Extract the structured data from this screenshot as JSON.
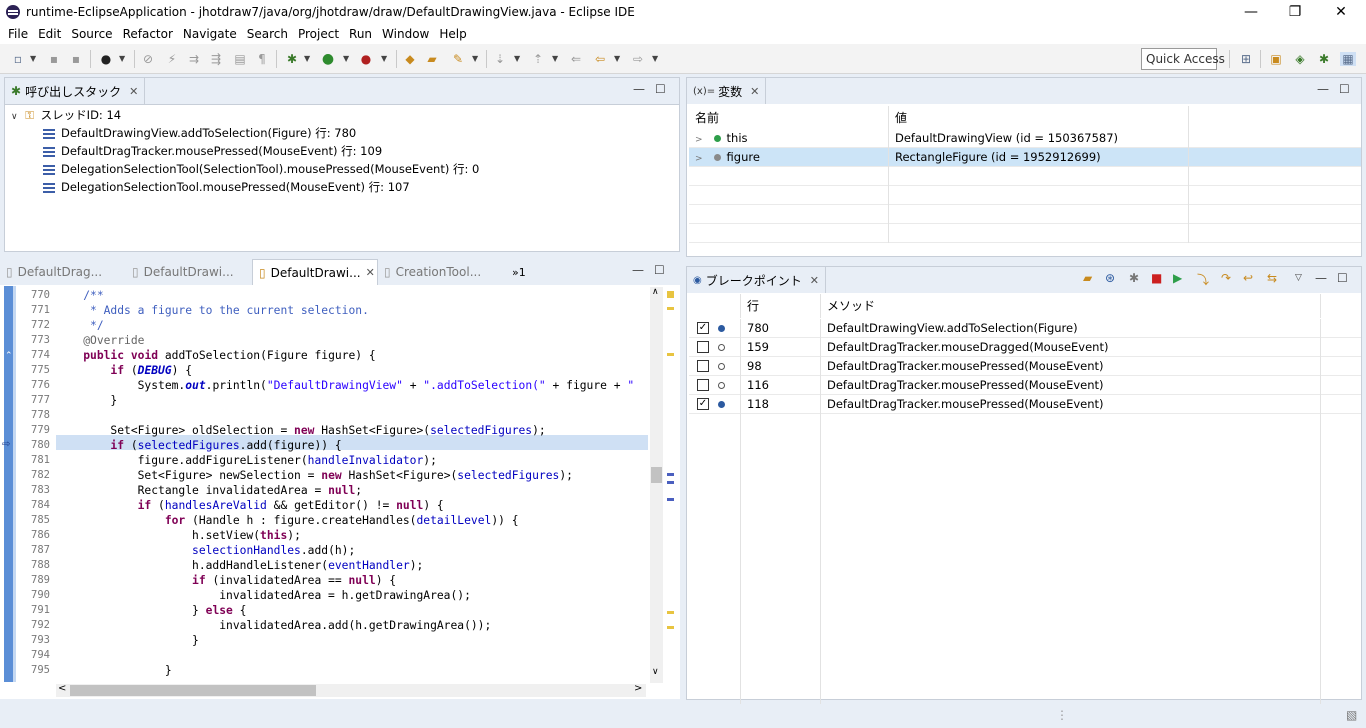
{
  "window": {
    "title": "runtime-EclipseApplication - jhotdraw7/java/org/jhotdraw/draw/DefaultDrawingView.java - Eclipse IDE",
    "minimize": "—",
    "restore": "❐",
    "close": "✕"
  },
  "menu": [
    "File",
    "Edit",
    "Source",
    "Refactor",
    "Navigate",
    "Search",
    "Project",
    "Run",
    "Window",
    "Help"
  ],
  "quick_access": "Quick Access",
  "callstack": {
    "tab": "呼び出しスタック",
    "thread": "スレッドID: 14",
    "frames": [
      "DefaultDrawingView.addToSelection(Figure) 行: 780",
      "DefaultDragTracker.mousePressed(MouseEvent) 行: 109",
      "DelegationSelectionTool(SelectionTool).mousePressed(MouseEvent) 行: 0",
      "DelegationSelectionTool.mousePressed(MouseEvent) 行: 107"
    ]
  },
  "variables": {
    "tab": "変数",
    "tab_prefix": "(x)=",
    "col_name": "名前",
    "col_value": "値",
    "rows": [
      {
        "name": "this",
        "value": "DefaultDrawingView (id = 150367587)"
      },
      {
        "name": "figure",
        "value": "RectangleFigure (id = 1952912699)"
      }
    ]
  },
  "editor": {
    "tabs": [
      "DefaultDrag...",
      "DefaultDrawi...",
      "DefaultDrawi...",
      "CreationTool..."
    ],
    "overflow": "»1",
    "lines": [
      {
        "n": "770",
        "h": "    <span class='cm'>/**</span>"
      },
      {
        "n": "771",
        "h": "     <span class='cm'>* Adds a figure to the current selection.</span>"
      },
      {
        "n": "772",
        "h": "     <span class='cm'>*/</span>"
      },
      {
        "n": "773",
        "h": "    <span class='an'>@Override</span>"
      },
      {
        "n": "774",
        "h": "    <span class='kw'>public</span> <span class='kw'>void</span> addToSelection(Figure figure) {"
      },
      {
        "n": "775",
        "h": "        <span class='kw'>if</span> (<span class='it'>DEBUG</span>) {"
      },
      {
        "n": "776",
        "h": "            System.<span class='it'>out</span>.println(<span class='st'>\"DefaultDrawingView\"</span> + <span class='st'>\".addToSelection(\"</span> + figure + <span class='st'>\"</span>"
      },
      {
        "n": "777",
        "h": "        }"
      },
      {
        "n": "778",
        "h": ""
      },
      {
        "n": "779",
        "h": "        Set&lt;Figure&gt; oldSelection = <span class='kw'>new</span> HashSet&lt;Figure&gt;(<span class='fd'>selectedFigures</span>);"
      },
      {
        "n": "780",
        "h": "        <span class='kw'>if</span> (<span class='fd'>selectedFigures</span>.add(figure)) {"
      },
      {
        "n": "781",
        "h": "            figure.addFigureListener(<span class='fd'>handleInvalidator</span>);"
      },
      {
        "n": "782",
        "h": "            Set&lt;Figure&gt; newSelection = <span class='kw'>new</span> HashSet&lt;Figure&gt;(<span class='fd'>selectedFigures</span>);"
      },
      {
        "n": "783",
        "h": "            Rectangle invalidatedArea = <span class='kw'>null</span>;"
      },
      {
        "n": "784",
        "h": "            <span class='kw'>if</span> (<span class='fd'>handlesAreValid</span> &amp;&amp; getEditor() != <span class='kw'>null</span>) {"
      },
      {
        "n": "785",
        "h": "                <span class='kw'>for</span> (Handle h : figure.createHandles(<span class='fd'>detailLevel</span>)) {"
      },
      {
        "n": "786",
        "h": "                    h.setView(<span class='kw'>this</span>);"
      },
      {
        "n": "787",
        "h": "                    <span class='fd'>selectionHandles</span>.add(h);"
      },
      {
        "n": "788",
        "h": "                    h.addHandleListener(<span class='fd'>eventHandler</span>);"
      },
      {
        "n": "789",
        "h": "                    <span class='kw'>if</span> (invalidatedArea == <span class='kw'>null</span>) {"
      },
      {
        "n": "790",
        "h": "                        invalidatedArea = h.getDrawingArea();"
      },
      {
        "n": "791",
        "h": "                    } <span class='kw'>else</span> {"
      },
      {
        "n": "792",
        "h": "                        invalidatedArea.add(h.getDrawingArea());"
      },
      {
        "n": "793",
        "h": "                    }"
      },
      {
        "n": "794",
        "h": ""
      },
      {
        "n": "795",
        "h": "                }"
      }
    ]
  },
  "breakpoints": {
    "tab": "ブレークポイント",
    "col_line": "行",
    "col_method": "メソッド",
    "rows": [
      {
        "checked": true,
        "line": "780",
        "method": "DefaultDrawingView.addToSelection(Figure)"
      },
      {
        "checked": false,
        "line": "159",
        "method": "DefaultDragTracker.mouseDragged(MouseEvent)"
      },
      {
        "checked": false,
        "line": "98",
        "method": "DefaultDragTracker.mousePressed(MouseEvent)"
      },
      {
        "checked": false,
        "line": "116",
        "method": "DefaultDragTracker.mousePressed(MouseEvent)"
      },
      {
        "checked": true,
        "line": "118",
        "method": "DefaultDragTracker.mousePressed(MouseEvent)"
      }
    ]
  }
}
